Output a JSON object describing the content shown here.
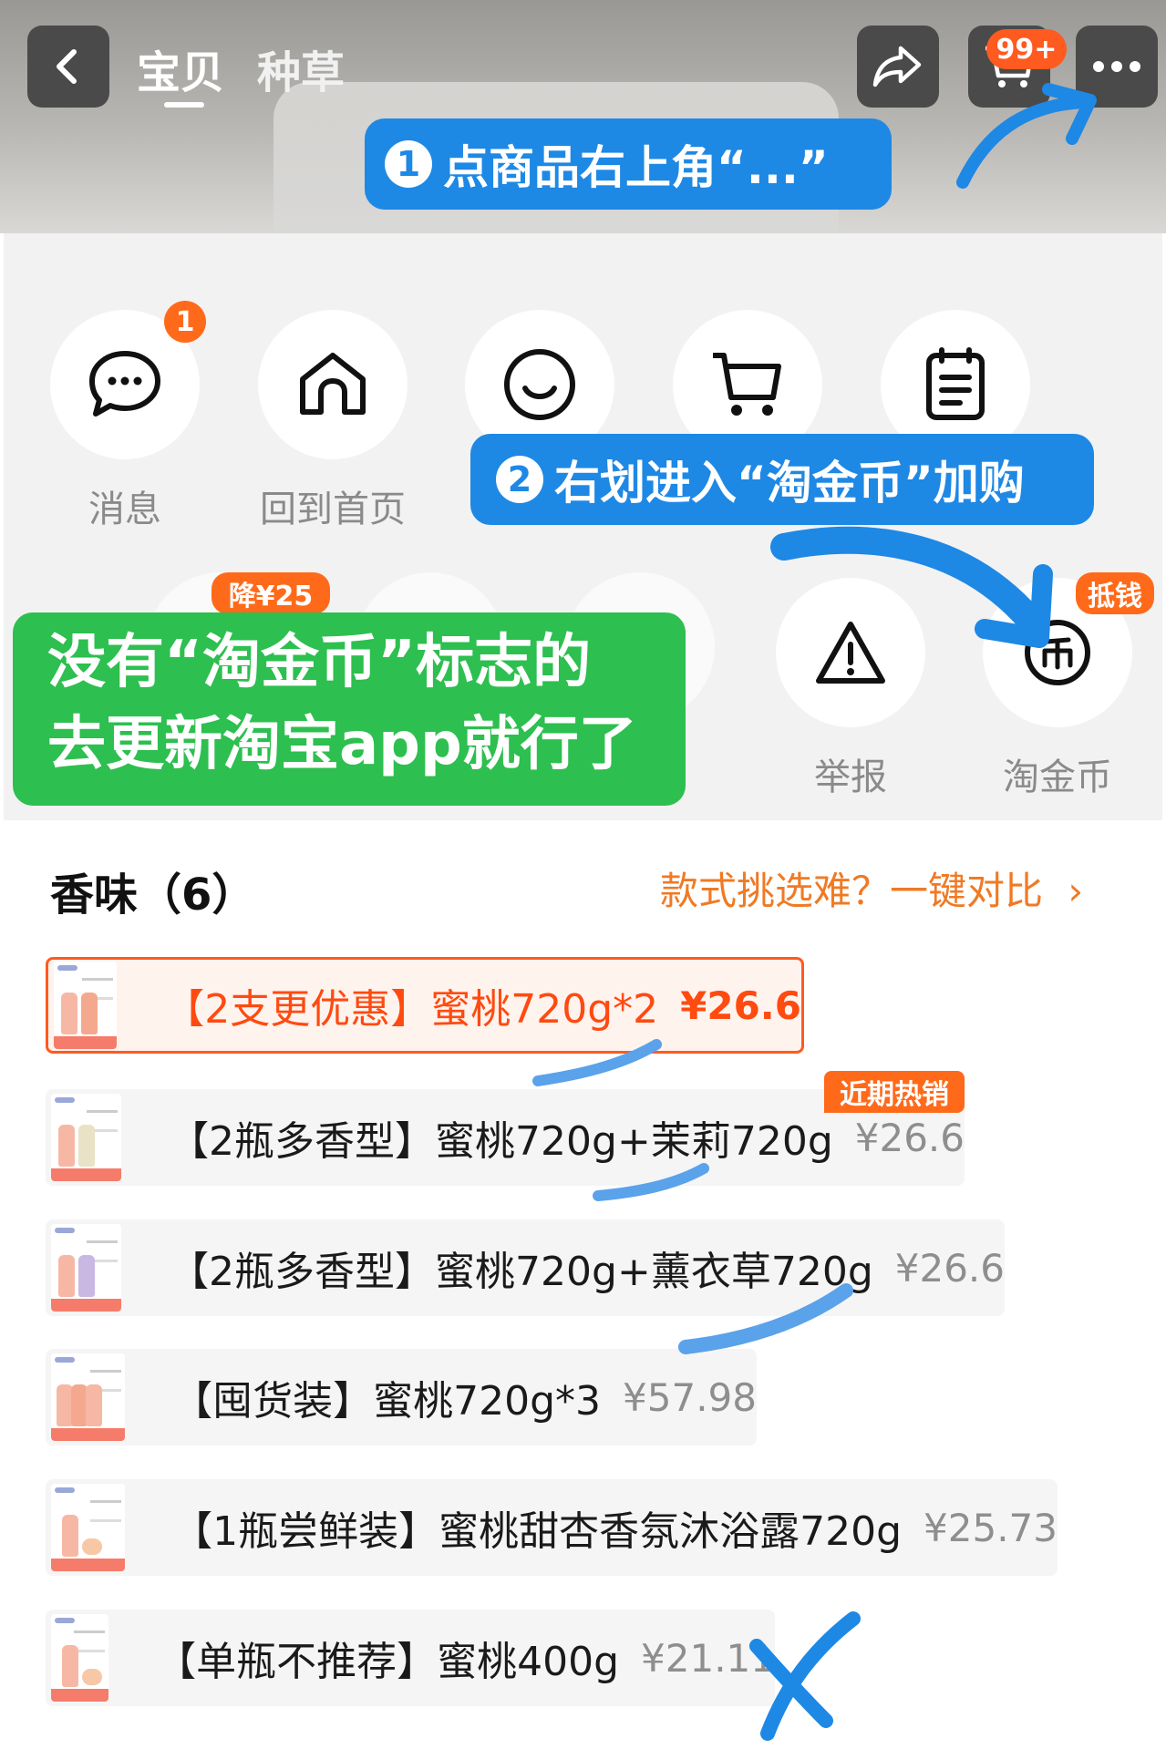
{
  "header": {
    "tabs": [
      {
        "label": "宝贝"
      },
      {
        "label": "种草"
      }
    ],
    "cart_badge": "99+",
    "icons": {
      "back": "chevron-left-icon",
      "share": "share-icon",
      "cart": "cart-icon",
      "more": "more-dots-icon"
    }
  },
  "annotations": {
    "step1_num": "1",
    "step1_text": "点商品右上角“...”",
    "step2_num": "2",
    "step2_text": "右划进入“淘金币”加购",
    "green_note_line1": "没有“淘金币”标志的",
    "green_note_line2": "去更新淘宝app就行了",
    "colors": {
      "callout": "#1e88e5",
      "green_note": "#2dbf4f",
      "accent": "#ff5a1f"
    }
  },
  "share_panel": {
    "row1": [
      {
        "label": "消息",
        "icon": "chat-bubble-icon",
        "badge": "1"
      },
      {
        "label": "回到首页",
        "icon": "home-icon"
      },
      {
        "label": "",
        "icon": "smile-icon"
      },
      {
        "label": "",
        "icon": "cart-icon"
      },
      {
        "label": "",
        "icon": "clipboard-icon"
      }
    ],
    "row2_tags": {
      "discount": "降¥25",
      "deduct": "抵钱"
    },
    "row2": [
      {
        "label": "举报",
        "icon": "warning-icon"
      },
      {
        "label": "淘金币",
        "icon": "taojinbi-coin-icon"
      }
    ]
  },
  "variants_section": {
    "title": "香味（6）",
    "compare_link": "款式挑选难？一键对比 ",
    "hot_tag": "近期热销",
    "items": [
      {
        "name": "【2支更优惠】蜜桃720g*2",
        "price": "¥26.6",
        "selected": true
      },
      {
        "name": "【2瓶多香型】蜜桃720g+茉莉720g",
        "price": "¥26.6",
        "selected": false
      },
      {
        "name": "【2瓶多香型】蜜桃720g+薰衣草720g",
        "price": "¥26.6",
        "selected": false
      },
      {
        "name": "【囤货装】蜜桃720g*3",
        "price": "¥57.98",
        "selected": false
      },
      {
        "name": "【1瓶尝鲜装】蜜桃甜杏香氛沐浴露720g",
        "price": "¥25.73",
        "selected": false
      },
      {
        "name": "【单瓶不推荐】蜜桃400g",
        "price": "¥21.11",
        "selected": false
      }
    ]
  }
}
